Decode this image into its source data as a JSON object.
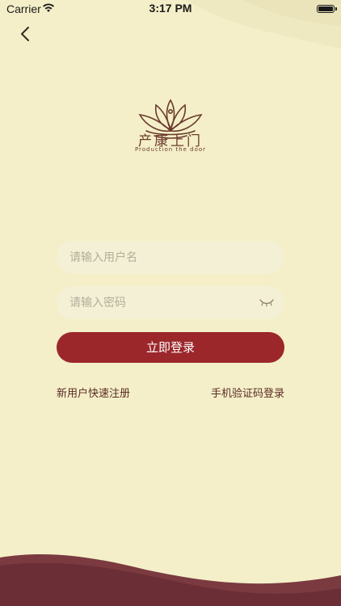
{
  "status_bar": {
    "carrier": "Carrier",
    "time": "3:17 PM"
  },
  "logo": {
    "title": "产康上门",
    "subtitle": "Production the door"
  },
  "login_form": {
    "username_placeholder": "请输入用户名",
    "password_placeholder": "请输入密码",
    "submit_label": "立即登录"
  },
  "links": {
    "register": "新用户快速注册",
    "sms_login": "手机验证码登录"
  },
  "colors": {
    "background": "#f4efc8",
    "primary": "#9b272b",
    "footer_wave": "#6b2e36",
    "text": "#5a2a25"
  },
  "icons": {
    "back": "chevron-left-icon",
    "wifi": "wifi-icon",
    "battery": "battery-icon",
    "logo": "lotus-logo-icon",
    "password_toggle": "eye-closed-icon"
  }
}
